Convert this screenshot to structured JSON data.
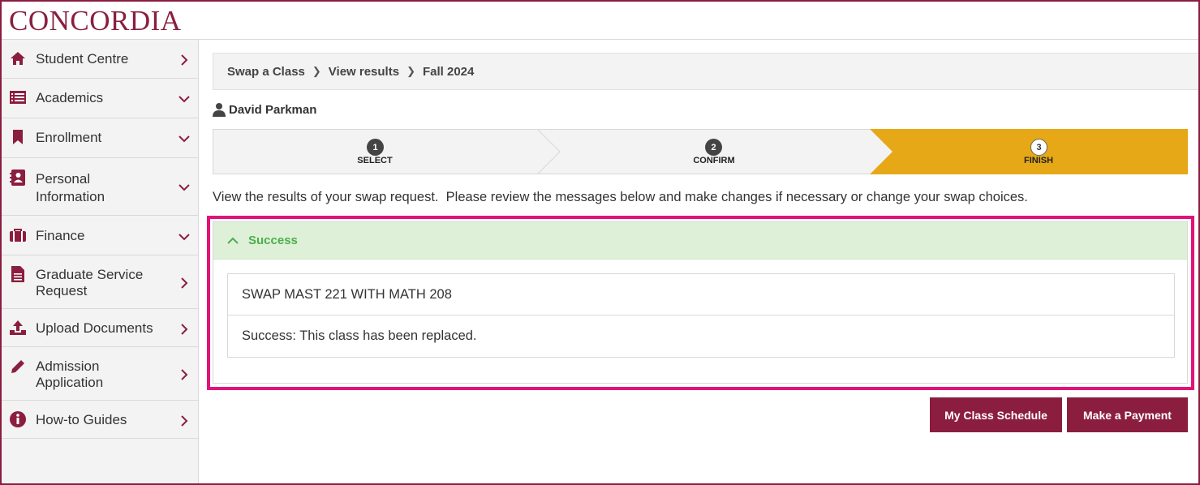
{
  "brand": {
    "logo_text": "CONCORDIA",
    "color": "#8b1e3f"
  },
  "sidebar": {
    "items": [
      {
        "label": "Student Centre",
        "icon": "home-icon",
        "chevron": "right"
      },
      {
        "label": "Academics",
        "icon": "list-icon",
        "chevron": "down"
      },
      {
        "label": "Enrollment",
        "icon": "bookmark-icon",
        "chevron": "down"
      },
      {
        "label": "Personal Information",
        "icon": "contact-card-icon",
        "chevron": "down"
      },
      {
        "label": "Finance",
        "icon": "briefcase-icon",
        "chevron": "down"
      },
      {
        "label": "Graduate Service Request",
        "icon": "document-icon",
        "chevron": "right"
      },
      {
        "label": "Upload Documents",
        "icon": "upload-icon",
        "chevron": "right"
      },
      {
        "label": "Admission Application",
        "icon": "pencil-icon",
        "chevron": "right"
      },
      {
        "label": "How-to Guides",
        "icon": "info-icon",
        "chevron": "right"
      }
    ]
  },
  "breadcrumb": {
    "items": [
      "Swap a Class",
      "View results",
      "Fall 2024"
    ]
  },
  "user": {
    "name": "David Parkman",
    "icon": "user-icon"
  },
  "steps": [
    {
      "number": "1",
      "label": "SELECT",
      "state": "done"
    },
    {
      "number": "2",
      "label": "CONFIRM",
      "state": "done"
    },
    {
      "number": "3",
      "label": "FINISH",
      "state": "active"
    }
  ],
  "intro_text": "View the results of your swap request.  Please review the messages below and make changes if necessary or change your swap choices.",
  "result_panel": {
    "title": "Success",
    "icon": "chevron-up-icon",
    "rows": [
      "SWAP MAST 221 WITH MATH  208",
      "Success: This class has been replaced."
    ]
  },
  "buttons": {
    "schedule": "My Class Schedule",
    "payment": "Make a Payment"
  },
  "colors": {
    "accent": "#8b1e3f",
    "step_active": "#e6a817",
    "success_bg": "#dff0d8",
    "success_text": "#4cae4c",
    "highlight": "#e2127a"
  }
}
